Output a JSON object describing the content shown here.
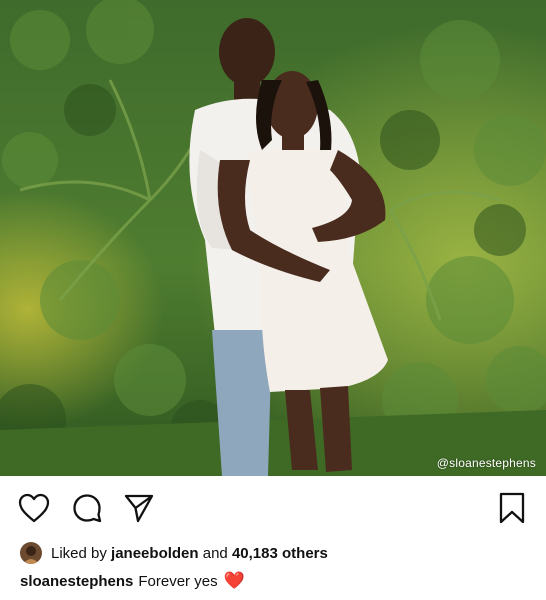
{
  "post": {
    "watermark": "@sloanestephens"
  },
  "actions": {
    "like_icon": "heart-outline-icon",
    "comment_icon": "comment-bubble-icon",
    "share_icon": "paper-plane-icon",
    "save_icon": "bookmark-icon"
  },
  "likes": {
    "prefix": "Liked by ",
    "user": "janeebolden",
    "middle": " and ",
    "count": "40,183 others"
  },
  "caption": {
    "username": "sloanestephens",
    "text": "Forever yes",
    "emoji": "❤️"
  },
  "colors": {
    "heart": "#d81b33",
    "text": "#111111",
    "background": "#ffffff"
  }
}
